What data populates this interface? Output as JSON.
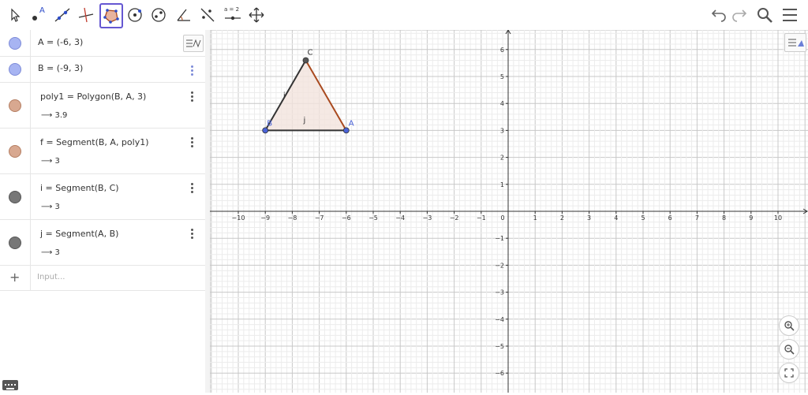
{
  "toolbar": {
    "tools": [
      "move-tool",
      "point-tool",
      "line-tool",
      "perpendicular-line-tool",
      "polygon-tool",
      "circle-tool",
      "conic-tool",
      "angle-tool",
      "reflect-tool",
      "slider-tool",
      "move-graphics-tool"
    ],
    "slider_label": "a = 2",
    "point_label": "A",
    "right_icons": [
      "undo-icon",
      "redo-icon",
      "search-icon",
      "menu-icon"
    ]
  },
  "algebra": {
    "items": [
      {
        "definition": "A = (-6, 3)",
        "value": "",
        "color": "#a7b4f2"
      },
      {
        "definition": "B = (-9, 3)",
        "value": "",
        "color": "#a7b4f2"
      },
      {
        "definition": "poly1 = Polygon(B, A, 3)",
        "value": "⟶ 3.9",
        "color": "#d8a890"
      },
      {
        "definition": "f = Segment(B, A, poly1)",
        "value": "⟶ 3",
        "color": "#d8a890"
      },
      {
        "definition": "i = Segment(B, C)",
        "value": "⟶ 3",
        "color": "#777777"
      },
      {
        "definition": "j = Segment(A, B)",
        "value": "⟶ 3",
        "color": "#777777"
      }
    ],
    "input_placeholder": "Input..."
  },
  "graphics": {
    "x_ticks": [
      "−10",
      "−9",
      "−8",
      "−7",
      "−6",
      "−5",
      "−4",
      "−3",
      "−2",
      "−1",
      "0",
      "1",
      "2",
      "3",
      "4",
      "5",
      "6",
      "7",
      "8",
      "9",
      "10"
    ],
    "y_ticks": [
      "6",
      "5",
      "4",
      "3",
      "2",
      "1",
      "−1",
      "−2",
      "−3",
      "−4",
      "−5",
      "−6"
    ],
    "points": [
      {
        "name": "A",
        "x": -6,
        "y": 3
      },
      {
        "name": "B",
        "x": -9,
        "y": 3
      },
      {
        "name": "C",
        "x": -7.5,
        "y": 5.6
      }
    ],
    "segment_labels": [
      "i",
      "j"
    ],
    "polygon_fill": "#f3e4dd",
    "polygon_stroke": "#a94a1f"
  }
}
